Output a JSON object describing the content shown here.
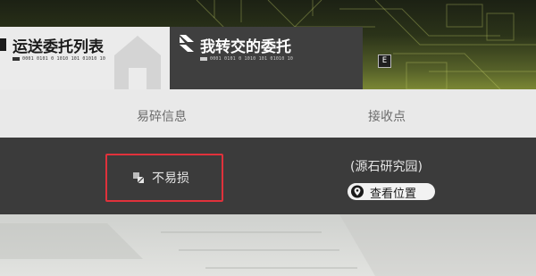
{
  "tabs": [
    {
      "label": "运送委托列表",
      "code": "0001 0101 0 1010 101 01010 10",
      "active": true
    },
    {
      "label": "我转交的委托",
      "code": "0001 0101 0 1010 101 01010 10",
      "active": false
    }
  ],
  "key_hint": "E",
  "table": {
    "headers": {
      "fragile": "易碎信息",
      "receiver": "接收点"
    },
    "row": {
      "fragile": "不易损",
      "receiver": "(源石研究园)",
      "view_button": "查看位置"
    }
  },
  "colors": {
    "highlight": "#e0313b",
    "accent_band": "#8f9c3a"
  },
  "icons": [
    "bookmark-icon",
    "house-icon",
    "arrow-icon",
    "fragile-icon",
    "location-pin-icon"
  ]
}
